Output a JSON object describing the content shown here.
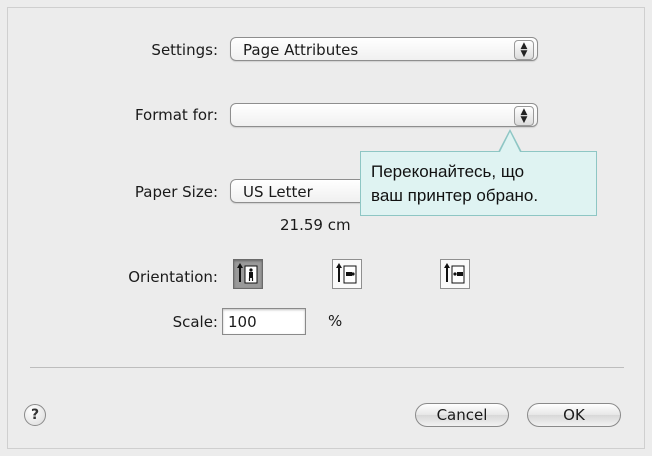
{
  "settings": {
    "label": "Settings:",
    "value": "Page Attributes"
  },
  "format_for": {
    "label": "Format for:",
    "value": ""
  },
  "paper_size": {
    "label": "Paper Size:",
    "value": "US Letter",
    "dimensions": "21.59 cm"
  },
  "orientation": {
    "label": "Orientation:",
    "options": [
      "portrait-icon",
      "landscape-icon",
      "reverse-landscape-icon"
    ],
    "selected": 0
  },
  "scale": {
    "label": "Scale:",
    "value": "100",
    "unit": "%"
  },
  "callout": {
    "line1": "Переконайтесь, що",
    "line2": "ваш принтер обрано."
  },
  "buttons": {
    "help": "?",
    "cancel": "Cancel",
    "ok": "OK"
  }
}
